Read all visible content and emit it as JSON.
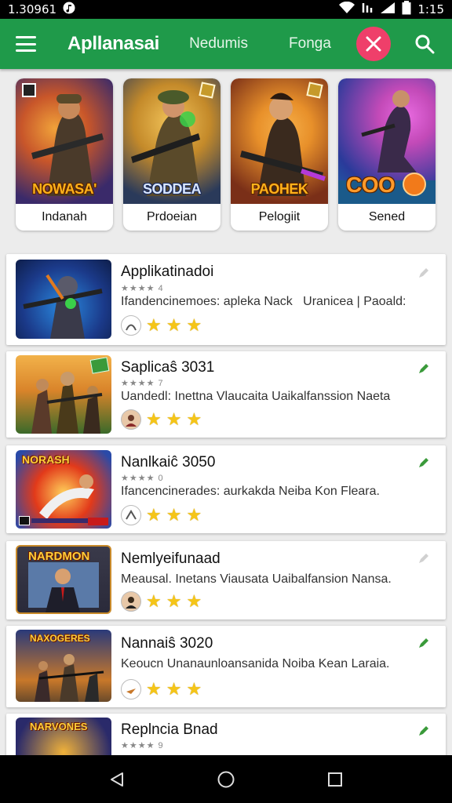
{
  "status": {
    "left_text": "1.30961",
    "time": "1:15"
  },
  "appbar": {
    "title": "Apllanasai",
    "tabs": [
      {
        "label": "Nedumis"
      },
      {
        "label": "Fonga"
      }
    ]
  },
  "featured": [
    {
      "name": "Indanah",
      "art_text": "NOWASA'",
      "colors": [
        "#3a2a6a",
        "#c8562a"
      ]
    },
    {
      "name": "Prdoeian",
      "art_text": "SODDEA",
      "colors": [
        "#c48a2a",
        "#2a3a5a"
      ]
    },
    {
      "name": "Pelogiit",
      "art_text": "PAOHEK",
      "colors": [
        "#7a2f18",
        "#e8902a"
      ]
    },
    {
      "name": "Sened",
      "art_text": "COO",
      "colors": [
        "#2a3a9a",
        "#c34ab8"
      ]
    }
  ],
  "list": [
    {
      "title": "Applikatinadoi",
      "meta": "★★★★ 4",
      "desc": "Ifandencinemoes: apleka Nack   Uranicea | Paoald:",
      "stars": 3,
      "thumb_colors": [
        "#1b3a8a",
        "#e07a20"
      ],
      "thumb_text": ""
    },
    {
      "title": "Saplicaŝ 3031",
      "meta": "★★★★ 7",
      "desc": "Uandedl: Inettna Vlaucaita Uaikalfanssion Naeta",
      "stars": 3,
      "thumb_colors": [
        "#d9842a",
        "#3a6a2a"
      ],
      "thumb_text": ""
    },
    {
      "title": "Nanlkaiĉ 3050",
      "meta": "★★★★ 0",
      "desc": "Ifancencinerades: aurkakda Neiba Kon Fleara.",
      "stars": 3,
      "thumb_colors": [
        "#e23a1a",
        "#2a4aa8"
      ],
      "thumb_text": "NORASH"
    },
    {
      "title": "Nemlyeifunaad",
      "meta": "",
      "desc": "Meausal. Inetans Viausata Uaibalfansion Nansa.",
      "stars": 3,
      "thumb_colors": [
        "#2a2a3a",
        "#c88a2a"
      ],
      "thumb_text": "NARDMON"
    },
    {
      "title": "Nannaiŝ 3020",
      "meta": "",
      "desc": "Keoucn Unanaunloansanida Noiba Kean Laraia.",
      "stars": 3,
      "thumb_colors": [
        "#2a3a7a",
        "#c8782a"
      ],
      "thumb_text": "NAXOGERES"
    },
    {
      "title": "Replncia Bnad",
      "meta": "★★★★ 9",
      "desc": "",
      "stars": 0,
      "thumb_colors": [
        "#2a2a6a",
        "#d89a2a"
      ],
      "thumb_text": "NARVONES"
    }
  ],
  "colors": {
    "appbar": "#1f9a4a",
    "close": "#ef3f6a",
    "star": "#f5c518"
  }
}
